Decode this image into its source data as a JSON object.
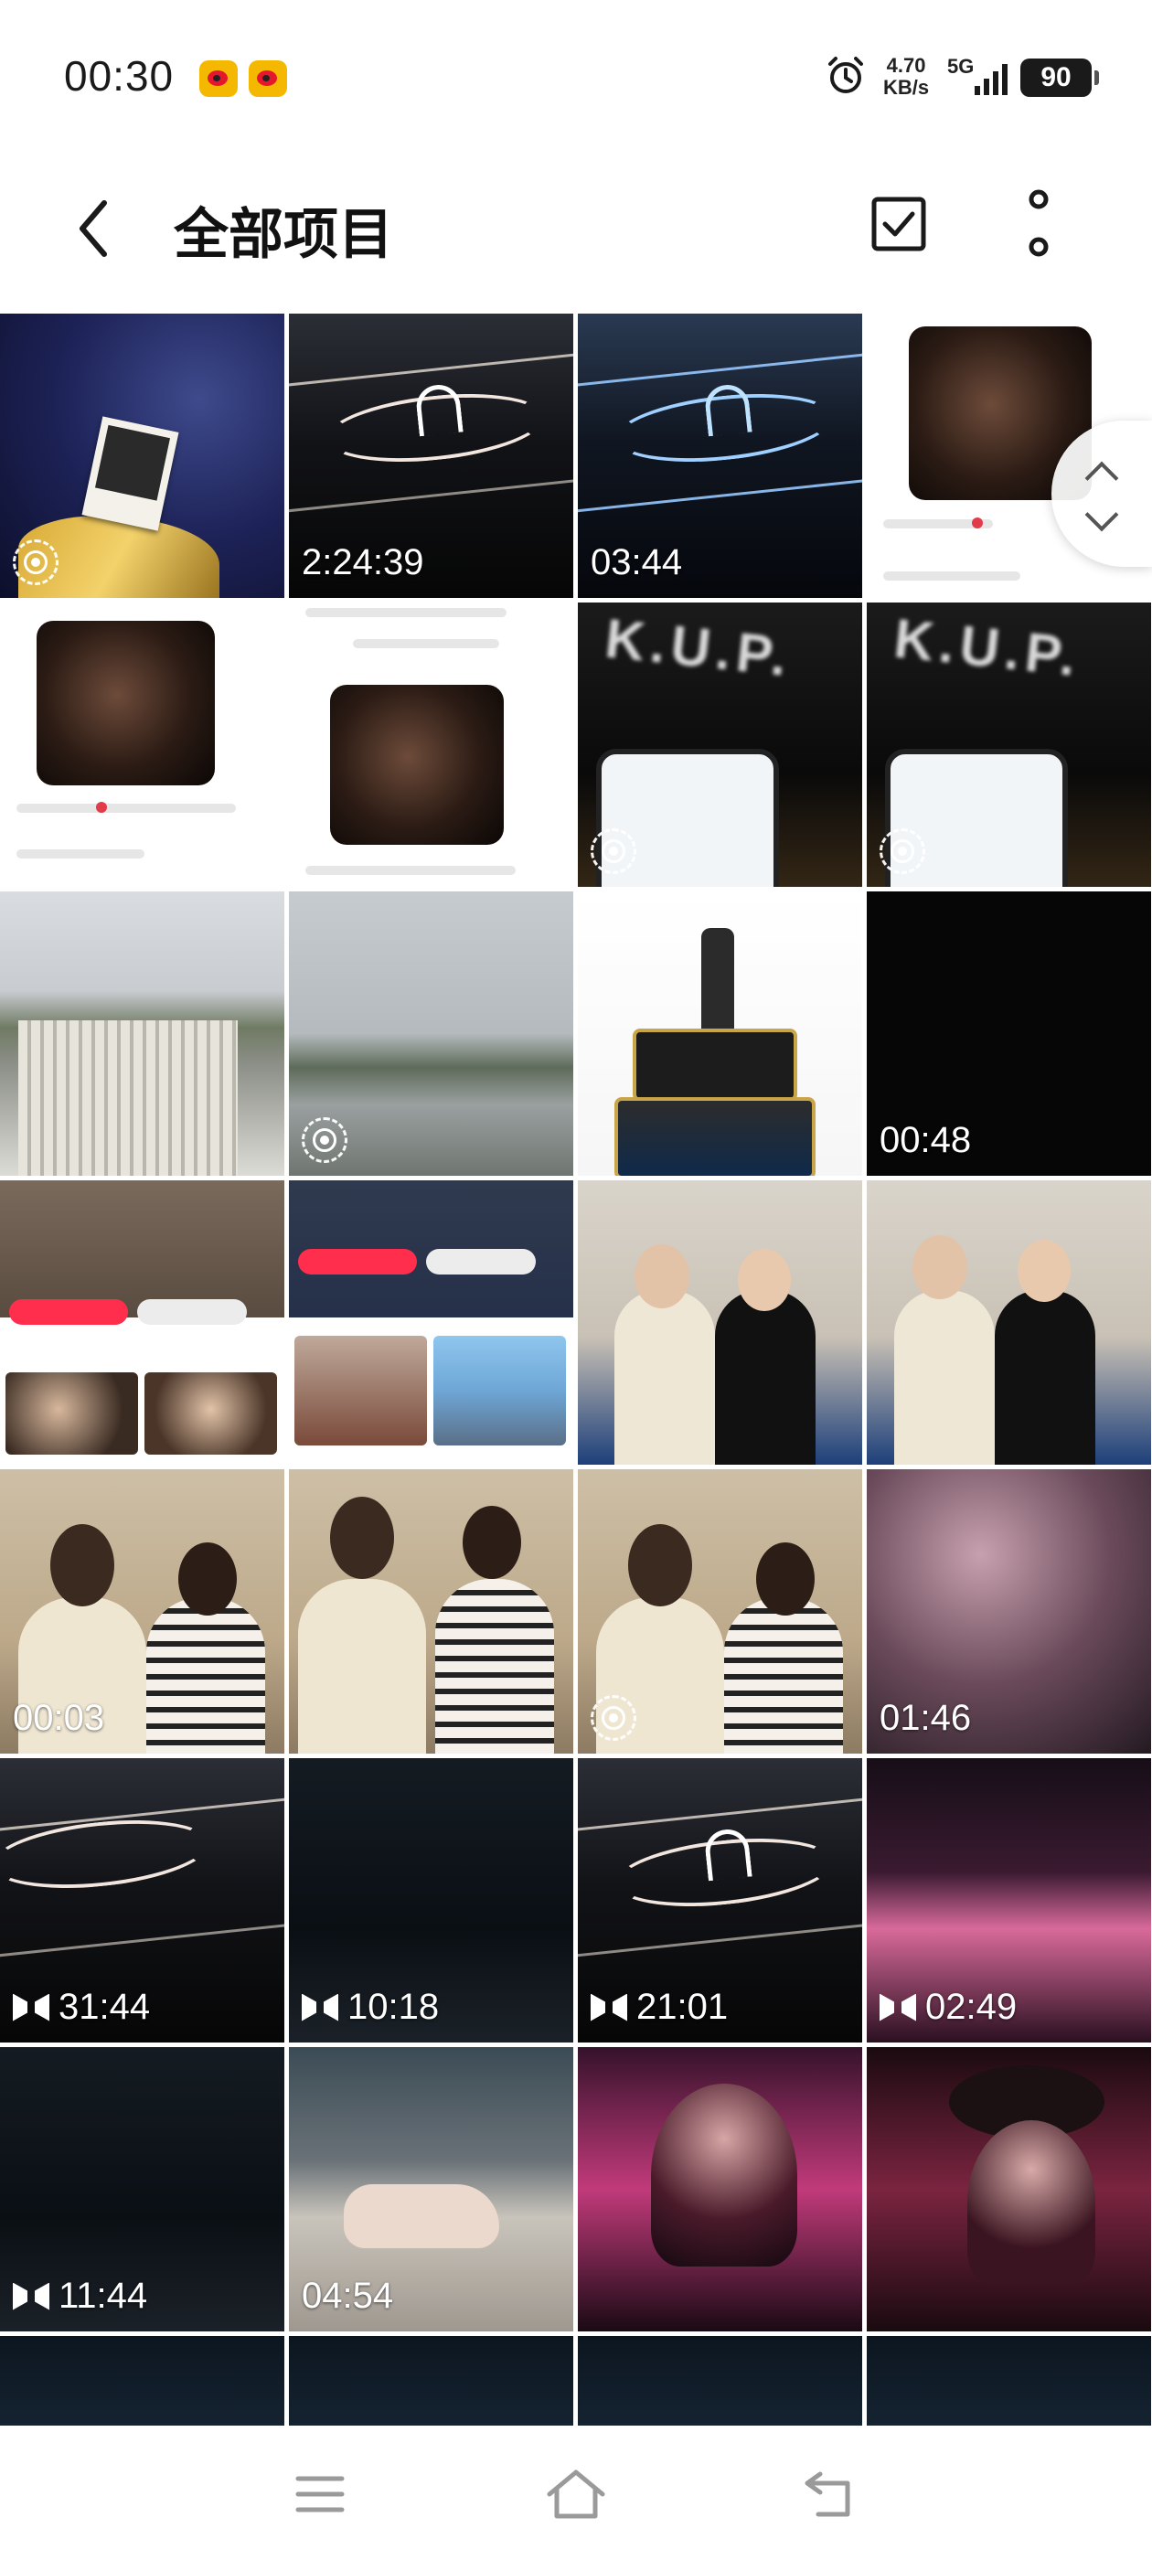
{
  "status_bar": {
    "time": "00:30",
    "speed_value": "4.70",
    "speed_unit": "KB/s",
    "network": "5G",
    "battery": "90"
  },
  "header": {
    "title": "全部项目",
    "back_icon": "chevron-left-icon",
    "select_icon": "checkbox-icon",
    "more_icon": "more-vertical-icon"
  },
  "grid": {
    "items": [
      {
        "kind": "live",
        "duration": ""
      },
      {
        "kind": "video",
        "duration": "2:24:39"
      },
      {
        "kind": "video",
        "duration": "03:44"
      },
      {
        "kind": "photo",
        "duration": ""
      },
      {
        "kind": "photo",
        "duration": ""
      },
      {
        "kind": "photo",
        "duration": ""
      },
      {
        "kind": "live",
        "duration": ""
      },
      {
        "kind": "live",
        "duration": ""
      },
      {
        "kind": "photo",
        "duration": ""
      },
      {
        "kind": "live",
        "duration": ""
      },
      {
        "kind": "photo",
        "duration": ""
      },
      {
        "kind": "video",
        "duration": "00:48"
      },
      {
        "kind": "photo",
        "duration": ""
      },
      {
        "kind": "photo",
        "duration": ""
      },
      {
        "kind": "photo",
        "duration": ""
      },
      {
        "kind": "photo",
        "duration": ""
      },
      {
        "kind": "video",
        "duration": "00:03"
      },
      {
        "kind": "photo",
        "duration": ""
      },
      {
        "kind": "live",
        "duration": ""
      },
      {
        "kind": "video",
        "duration": "01:46"
      },
      {
        "kind": "slowmo",
        "duration": "31:44"
      },
      {
        "kind": "slowmo",
        "duration": "10:18"
      },
      {
        "kind": "slowmo",
        "duration": "21:01"
      },
      {
        "kind": "slowmo",
        "duration": "02:49"
      },
      {
        "kind": "slowmo",
        "duration": "11:44"
      },
      {
        "kind": "video",
        "duration": "04:54"
      },
      {
        "kind": "photo",
        "duration": ""
      },
      {
        "kind": "photo",
        "duration": ""
      },
      {
        "kind": "photo",
        "duration": ""
      },
      {
        "kind": "photo",
        "duration": ""
      },
      {
        "kind": "photo",
        "duration": ""
      },
      {
        "kind": "photo",
        "duration": ""
      }
    ]
  },
  "nav_bar": {
    "menu_icon": "menu-icon",
    "home_icon": "home-icon",
    "back_icon": "back-icon"
  }
}
